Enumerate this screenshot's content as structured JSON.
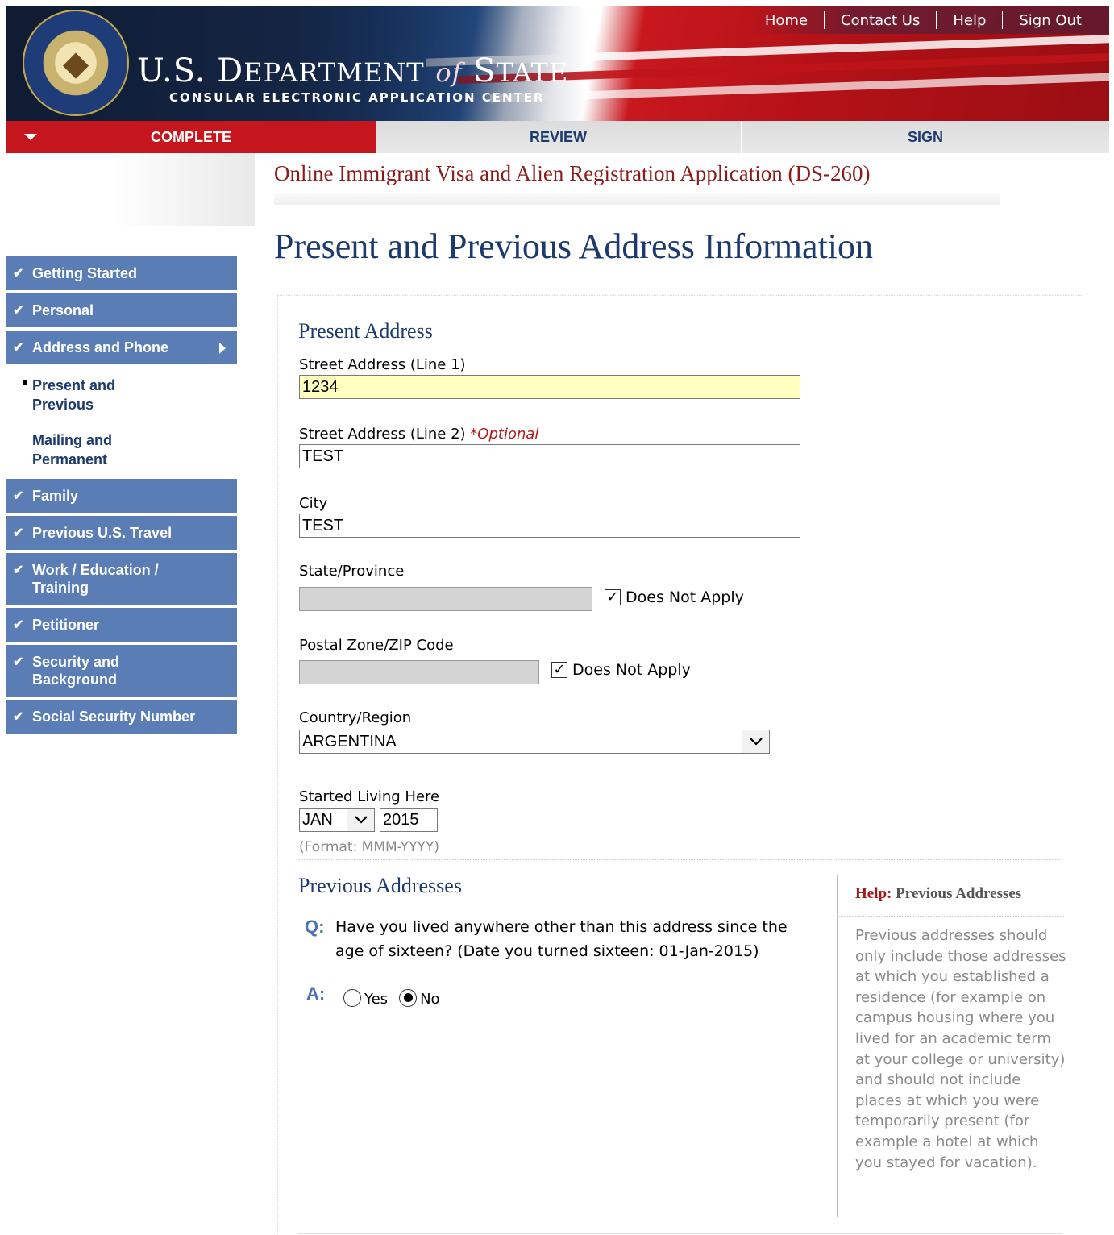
{
  "header": {
    "top_nav": [
      "Home",
      "Contact Us",
      "Help",
      "Sign Out"
    ],
    "brand_title_1": "U.S. D",
    "brand_title_1_sc": "EPARTMENT",
    "brand_title_of": "of",
    "brand_title_2": "S",
    "brand_title_2_sc": "TATE",
    "brand_subtitle": "CONSULAR ELECTRONIC APPLICATION CENTER"
  },
  "steps": [
    "COMPLETE",
    "REVIEW",
    "SIGN"
  ],
  "sidebar": {
    "items": [
      {
        "label": "Getting Started"
      },
      {
        "label": "Personal"
      },
      {
        "label": "Address and Phone"
      },
      {
        "label": "Present and Previous"
      },
      {
        "label": "Mailing and Permanent"
      },
      {
        "label": "Family"
      },
      {
        "label": "Previous U.S. Travel"
      },
      {
        "label": "Work / Education / Training"
      },
      {
        "label": "Petitioner"
      },
      {
        "label": "Security and Background"
      },
      {
        "label": "Social Security Number"
      }
    ]
  },
  "main": {
    "app_title": "Online Immigrant Visa and Alien Registration Application (DS-260)",
    "page_title": "Present and Previous Address Information",
    "present_address": {
      "section_title": "Present Address",
      "street1_label": "Street Address (Line 1)",
      "street1_value": "1234",
      "street2_label": "Street Address (Line 2)",
      "street2_optional": "*Optional",
      "street2_value": "TEST",
      "city_label": "City",
      "city_value": "TEST",
      "state_label": "State/Province",
      "state_value": "",
      "state_dna_label": "Does Not Apply",
      "postal_label": "Postal Zone/ZIP Code",
      "postal_value": "",
      "postal_dna_label": "Does Not Apply",
      "country_label": "Country/Region",
      "country_value": "ARGENTINA",
      "started_label": "Started Living Here",
      "started_month": "JAN",
      "started_year": "2015",
      "format_hint": "(Format: MMM-YYYY)"
    },
    "previous_addresses": {
      "section_title": "Previous Addresses",
      "q_marker": "Q:",
      "question": "Have you lived anywhere other than this address since the age of sixteen? (Date you turned sixteen: 01-Jan-2015)",
      "a_marker": "A:",
      "yes_label": "Yes",
      "no_label": "No",
      "selected": "No"
    },
    "help": {
      "title_prefix": "Help:",
      "title": "Previous Addresses",
      "body": "Previous addresses should only include those addresses at which you established a residence (for example on campus housing where you lived for an academic term at your college or university) and should not include places at which you were temporarily present (for example a hotel at which you stayed for vacation)."
    }
  },
  "colors": {
    "accent_red": "#c4161c",
    "nav_blue": "#5a7db5",
    "title_navy": "#1d3a6e",
    "title_red": "#8b1a1a"
  },
  "icons": {
    "check": "check-icon",
    "caret": "caret-down-icon",
    "arrow": "arrow-right-icon",
    "seal": "department-seal-icon"
  }
}
